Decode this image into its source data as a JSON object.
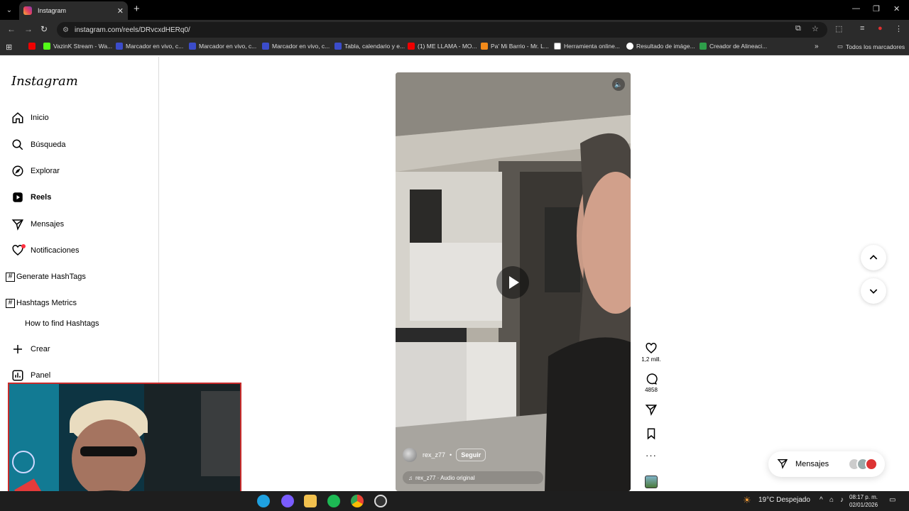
{
  "browser": {
    "tab_title": "Instagram",
    "url": "instagram.com/reels/DRvcxdHERq0/",
    "bookmarks": [
      "VazinK Stream - Wa...",
      "Marcador en vivo, c...",
      "Marcador en vivo, c...",
      "Marcador en vivo, c...",
      "Tabla, calendario y e...",
      "(1) ME LLAMA - MO...",
      "Pa' Mi Barrio - Mr. L...",
      "Herramienta online...",
      "Resultado de imáge...",
      "Creador de Alineaci..."
    ],
    "all_bookmarks": "Todos los marcadores"
  },
  "sidebar": {
    "logo": "Instagram",
    "items": [
      {
        "label": "Inicio",
        "icon": "home-icon"
      },
      {
        "label": "Búsqueda",
        "icon": "search-icon"
      },
      {
        "label": "Explorar",
        "icon": "compass-icon"
      },
      {
        "label": "Reels",
        "icon": "reels-icon"
      },
      {
        "label": "Mensajes",
        "icon": "send-icon"
      },
      {
        "label": "Notificaciones",
        "icon": "heart-icon"
      }
    ],
    "extension_items": [
      "Generate HashTags",
      "Hashtags Metrics"
    ],
    "sub_link": "How to find Hashtags",
    "create": "Crear",
    "panel": "Panel"
  },
  "reel": {
    "username": "rex_z77",
    "separator": "•",
    "follow": "Seguir",
    "audio": "rex_z77 · Audio original",
    "likes": "1,2 mill.",
    "comments": "4858"
  },
  "messages": {
    "label": "Mensajes"
  },
  "taskbar": {
    "weather": "19°C  Despejado",
    "time": "08:17 p. m.",
    "date": "02/01/2026"
  }
}
